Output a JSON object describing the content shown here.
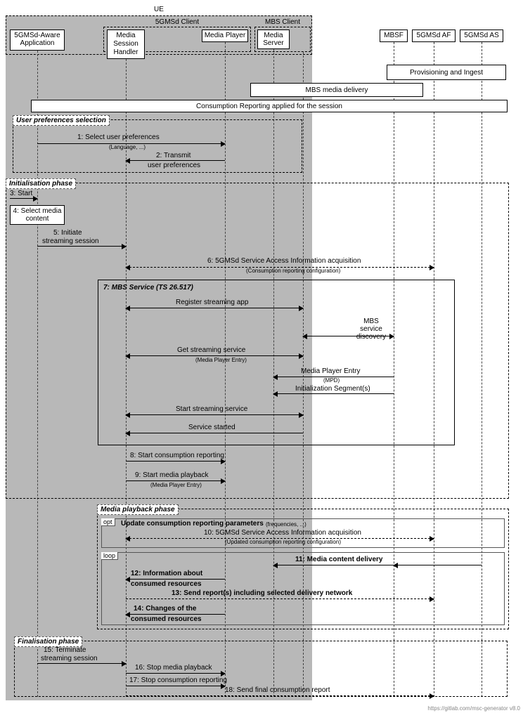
{
  "participants": {
    "ue": "UE",
    "client5g": "5GMSd Client",
    "mbs_client": "MBS Client",
    "app": "5GMSd-Aware Application",
    "msh": "Media Session Handler",
    "media_player": "Media Player",
    "media_server": "Media Server",
    "mbsf": "MBSF",
    "af": "5GMSd AF",
    "as": "5GMSd AS"
  },
  "bars": {
    "prov": "Provisioning and Ingest",
    "mbs_delivery": "MBS media delivery",
    "consump_applied": "Consumption Reporting applied for the session"
  },
  "frames": {
    "user_pref": "User preferences selection",
    "init": "Initialisation phase",
    "mbs_service": "7: MBS Service (TS 26.517)",
    "playback": "Media playback phase",
    "final": "Finalisation phase",
    "opt": "opt",
    "loop": "loop",
    "opt_label": "Update consumption reporting parameters",
    "opt_sub": "(frequencies, ...)"
  },
  "messages": {
    "m1": "1: Select user preferences",
    "m1_sub": "(Language, ...)",
    "m2": "2: Transmit",
    "m2b": "user preferences",
    "m3": "3: Start",
    "m4": "4: Select media content",
    "m5": "5: Initiate",
    "m5b": "streaming session",
    "m6": "6: 5GMSd Service Access Information acquisition",
    "m6_sub": "(Consumption reporting configuration)",
    "reg": "Register streaming app",
    "mbs_disc": "MBS service discovery",
    "get_ss": "Get streaming service",
    "get_ss_sub": "(Media Player Entry)",
    "mpe": "Media Player Entry",
    "mpe_sub": "(MPD)",
    "init_seg": "Initialization Segment(s)",
    "start_ss": "Start streaming service",
    "svc_started": "Service started",
    "m8": "8: Start consumption reporting",
    "m9": "9: Start media playback",
    "m9_sub": "(Media Player Entry)",
    "m10": "10: 5GMSd Service Access Information acquisition",
    "m10_sub": "(Updated consumption reporting configuration)",
    "m11": "11: Media content delivery",
    "m12": "12: Information about",
    "m12b": "consumed resources",
    "m13": "13: Send report(s) including selected delivery network",
    "m14": "14: Changes of the",
    "m14b": "consumed resources",
    "m15": "15: Terminate",
    "m15b": "streaming session",
    "m16": "16: Stop media playback",
    "m17": "17: Stop consumption reporting",
    "m18": "18: Send final consumption report"
  },
  "footer": "https://gitlab.com/msc-generator v8.0"
}
